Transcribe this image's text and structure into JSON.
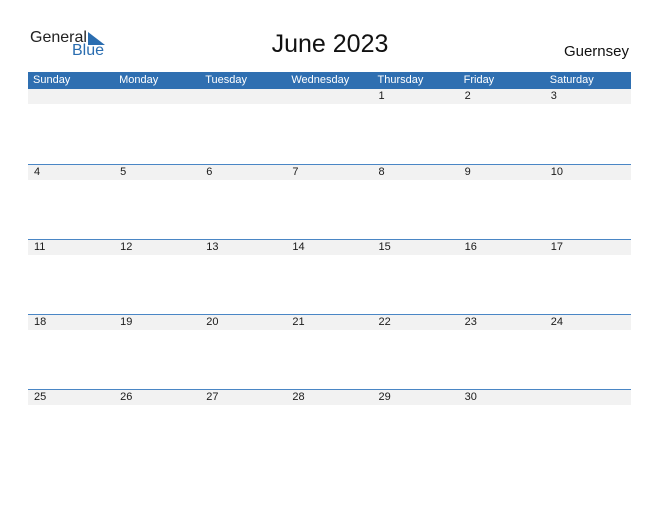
{
  "logo": {
    "line1": "General",
    "line2": "Blue"
  },
  "title": "June 2023",
  "country": "Guernsey",
  "colors": {
    "accent": "#2f6fb1",
    "strip": "#f2f2f2"
  },
  "weekdays": [
    "Sunday",
    "Monday",
    "Tuesday",
    "Wednesday",
    "Thursday",
    "Friday",
    "Saturday"
  ],
  "weeks": [
    [
      "",
      "",
      "",
      "",
      "1",
      "2",
      "3"
    ],
    [
      "4",
      "5",
      "6",
      "7",
      "8",
      "9",
      "10"
    ],
    [
      "11",
      "12",
      "13",
      "14",
      "15",
      "16",
      "17"
    ],
    [
      "18",
      "19",
      "20",
      "21",
      "22",
      "23",
      "24"
    ],
    [
      "25",
      "26",
      "27",
      "28",
      "29",
      "30",
      ""
    ]
  ]
}
